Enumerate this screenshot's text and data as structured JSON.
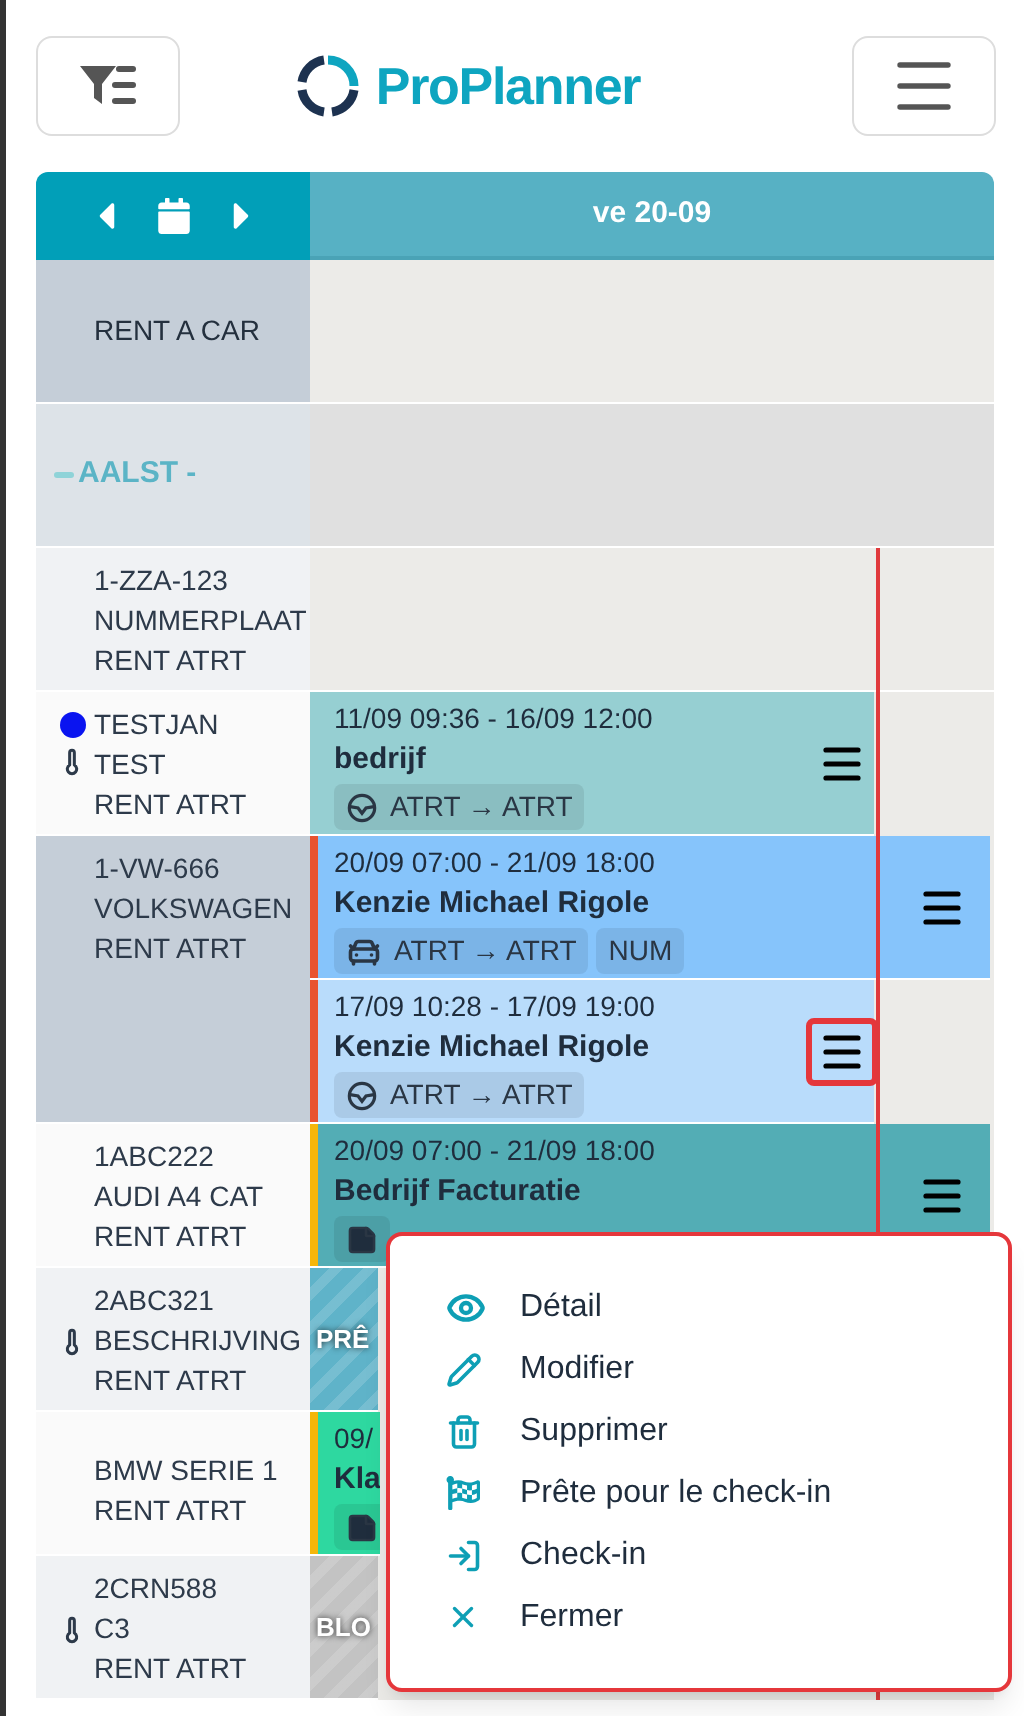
{
  "header": {
    "logo_text": "ProPlanner"
  },
  "calendar": {
    "date": "ve 20-09"
  },
  "rows": [
    {
      "kind": "group",
      "lines": [
        "RENT A CAR"
      ]
    },
    {
      "kind": "location",
      "label": "AALST -"
    },
    {
      "kind": "vehicle",
      "selected": false,
      "lines": [
        "1-ZZA-123",
        "NUMMERPLAAT",
        "RENT ATRT"
      ],
      "bookings": []
    },
    {
      "kind": "vehicle",
      "selected": false,
      "status_dot": {
        "color": "#0a14f0"
      },
      "thermometer": true,
      "lines": [
        "TESTJAN",
        "TEST",
        "RENT ATRT"
      ],
      "bookings": [
        {
          "kind": "booking",
          "color": "#96cfd2",
          "continues": false,
          "covered": false,
          "menu_button": {
            "highlighted": false
          },
          "dates": "11/09 09:36 - 16/09 12:00",
          "name": "bedrijf",
          "tags": [
            {
              "kind": "wheel",
              "text": "ATRT → ATRT"
            }
          ]
        }
      ]
    },
    {
      "kind": "vehicle",
      "selected": true,
      "lines": [
        "1-VW-666",
        "VOLKSWAGEN",
        "RENT ATRT"
      ],
      "bookings": [
        {
          "kind": "booking",
          "color": "#86c4fb",
          "status": {
            "color": "#e8532f"
          },
          "continues": true,
          "covered": false,
          "menu_button": {
            "highlighted": false
          },
          "dates": "20/09 07:00 - 21/09 18:00",
          "name": "Kenzie Michael Rigole",
          "tags": [
            {
              "kind": "cars",
              "text": "ATRT → ATRT"
            },
            {
              "kind": "plain",
              "text": "NUM"
            }
          ]
        },
        {
          "kind": "booking",
          "color": "#b9dcfb",
          "status": {
            "color": "#e8532f"
          },
          "continues": false,
          "covered": false,
          "menu_button": {
            "highlighted": true
          },
          "dates": "17/09 10:28 - 17/09 19:00",
          "name": "Kenzie Michael Rigole",
          "tags": [
            {
              "kind": "wheel",
              "text": "ATRT → ATRT"
            }
          ]
        }
      ]
    },
    {
      "kind": "vehicle",
      "selected": false,
      "lines": [
        "1ABC222",
        "AUDI A4 CAT",
        "RENT ATRT"
      ],
      "bookings": [
        {
          "kind": "booking",
          "color": "#53adb5",
          "status": {
            "color": "#f5b60a"
          },
          "continues": true,
          "covered": false,
          "menu_button": {
            "highlighted": false
          },
          "dates": "20/09 07:00 - 21/09 18:00",
          "name": "Bedrijf Facturatie",
          "tags": [
            {
              "kind": "note"
            }
          ]
        }
      ]
    },
    {
      "kind": "vehicle",
      "selected": false,
      "thermometer": true,
      "lines": [
        "2ABC321",
        "BESCHRIJVING",
        "RENT ATRT"
      ],
      "bookings": [
        {
          "kind": "blocked",
          "color": "#5fb3c9",
          "label": "PRÊ"
        }
      ]
    },
    {
      "kind": "vehicle",
      "selected": false,
      "lines": [
        "BMW SERIE 1",
        "RENT ATRT"
      ],
      "bookings": [
        {
          "kind": "booking",
          "color": "#2ed8a0",
          "status": {
            "color": "#f5b60a"
          },
          "covered": true,
          "dates": "09/",
          "name": "Kla",
          "tags": [
            {
              "kind": "note"
            }
          ]
        }
      ]
    },
    {
      "kind": "vehicle",
      "selected": false,
      "thermometer": true,
      "lines": [
        "2CRN588",
        "C3",
        "RENT ATRT"
      ],
      "bookings": [
        {
          "kind": "blocked",
          "color": "#c3c3c3",
          "label": "BLO"
        }
      ]
    }
  ],
  "context_menu": {
    "items": [
      {
        "kind": "eye",
        "label": "Détail"
      },
      {
        "kind": "pencil",
        "label": "Modifier"
      },
      {
        "kind": "trash",
        "label": "Supprimer"
      },
      {
        "kind": "flag",
        "label": "Prête pour le check-in"
      },
      {
        "kind": "login",
        "label": "Check-in"
      },
      {
        "kind": "close",
        "label": "Fermer"
      }
    ]
  }
}
